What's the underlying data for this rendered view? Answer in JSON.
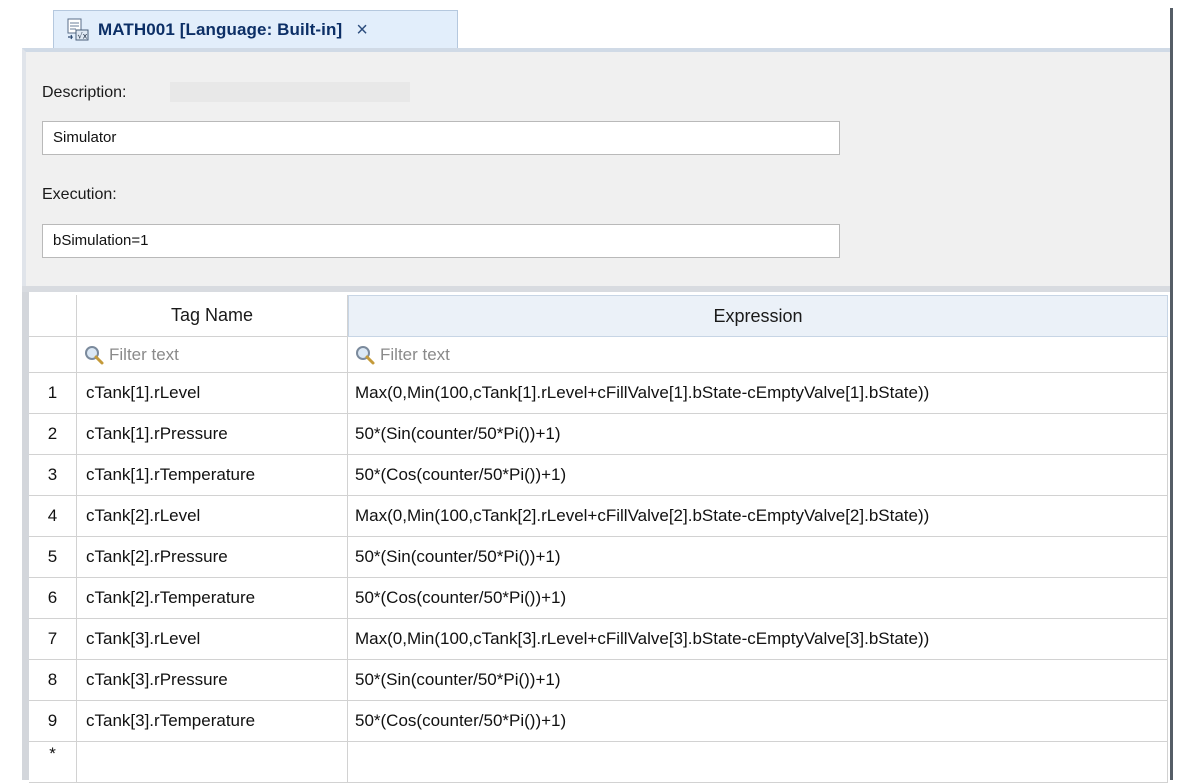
{
  "tab": {
    "title": "MATH001 [Language: Built-in]",
    "close": "×",
    "icon": "math-worksheet-icon"
  },
  "properties": {
    "description_label": "Description:",
    "description_value": "Simulator",
    "execution_label": "Execution:",
    "execution_value": "bSimulation=1"
  },
  "grid": {
    "columns": [
      "Tag Name",
      "Expression"
    ],
    "filter_placeholder": "Filter text",
    "new_row_marker": "*",
    "rows": [
      {
        "num": "1",
        "tag": "cTank[1].rLevel",
        "expr": "Max(0,Min(100,cTank[1].rLevel+cFillValve[1].bState-cEmptyValve[1].bState))"
      },
      {
        "num": "2",
        "tag": "cTank[1].rPressure",
        "expr": "50*(Sin(counter/50*Pi())+1)"
      },
      {
        "num": "3",
        "tag": "cTank[1].rTemperature",
        "expr": "50*(Cos(counter/50*Pi())+1)"
      },
      {
        "num": "4",
        "tag": "cTank[2].rLevel",
        "expr": "Max(0,Min(100,cTank[2].rLevel+cFillValve[2].bState-cEmptyValve[2].bState))"
      },
      {
        "num": "5",
        "tag": "cTank[2].rPressure",
        "expr": "50*(Sin(counter/50*Pi())+1)"
      },
      {
        "num": "6",
        "tag": "cTank[2].rTemperature",
        "expr": "50*(Cos(counter/50*Pi())+1)"
      },
      {
        "num": "7",
        "tag": "cTank[3].rLevel",
        "expr": "Max(0,Min(100,cTank[3].rLevel+cFillValve[3].bState-cEmptyValve[3].bState))"
      },
      {
        "num": "8",
        "tag": "cTank[3].rPressure",
        "expr": "50*(Sin(counter/50*Pi())+1)"
      },
      {
        "num": "9",
        "tag": "cTank[3].rTemperature",
        "expr": "50*(Cos(counter/50*Pi())+1)"
      }
    ]
  },
  "colors": {
    "tab_background": "#e2eefb",
    "tab_text": "#0c2f66",
    "panel_background": "#f0f0f0",
    "expression_header": "#ebf1f8",
    "grid_line": "#d2d2d2"
  }
}
